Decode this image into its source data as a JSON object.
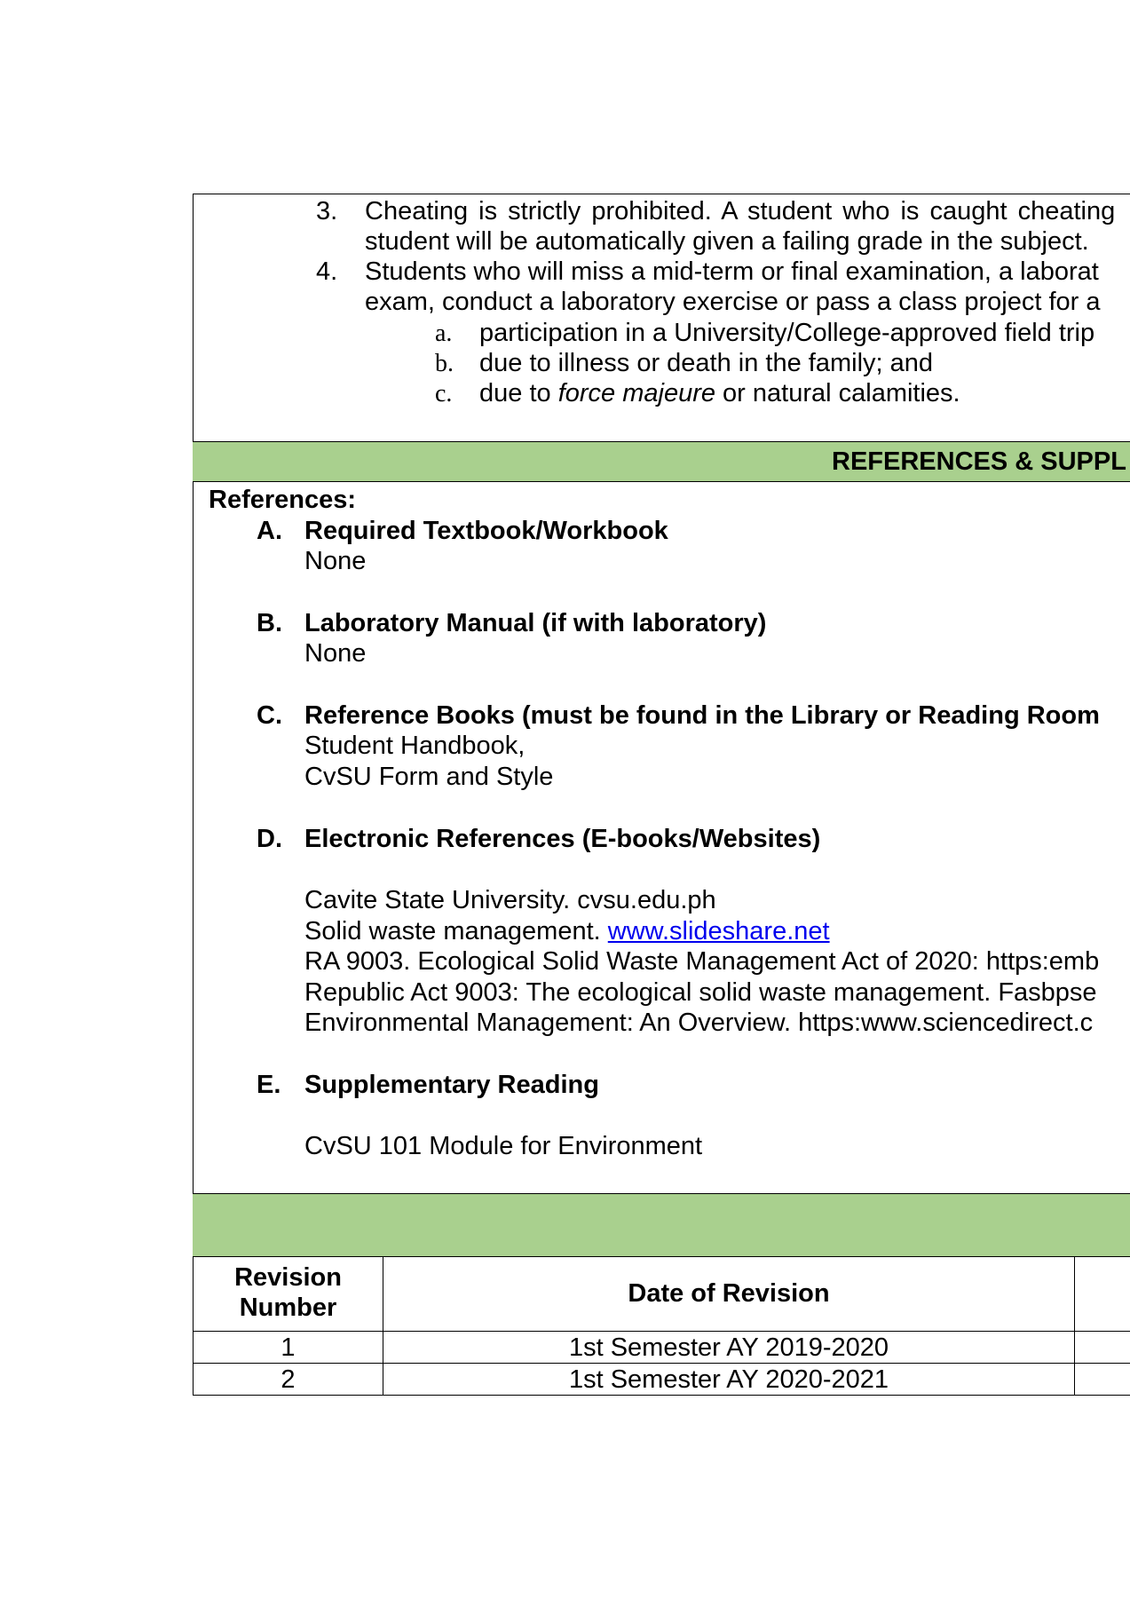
{
  "policies": [
    {
      "num": "3.",
      "lines": [
        "Cheating is strictly prohibited. A student who is caught cheating",
        "student will be automatically given a failing grade in the subject."
      ]
    },
    {
      "num": "4.",
      "lines": [
        "Students who will miss a mid-term or final examination, a laborat",
        "exam, conduct a laboratory exercise or pass a class project for a"
      ]
    }
  ],
  "subitems": [
    {
      "letter": "a.",
      "text": "participation in a University/College-approved field trip"
    },
    {
      "letter": "b.",
      "text": "due to illness or death in the family; and"
    },
    {
      "letter": "c.",
      "pre": "due to ",
      "italic": "force majeure",
      "post": " or natural calamities."
    }
  ],
  "section_header": "REFERENCES & SUPPL",
  "references": {
    "title": "References:",
    "A": {
      "letter": "A.",
      "heading": "Required Textbook/Workbook",
      "items": [
        "None"
      ]
    },
    "B": {
      "letter": "B.",
      "heading": "Laboratory Manual (if with laboratory)",
      "items": [
        "None"
      ]
    },
    "C": {
      "letter": "C.",
      "heading": "Reference Books (must be found in the Library or Reading Room",
      "items": [
        "Student Handbook,",
        "CvSU Form and Style"
      ]
    },
    "D": {
      "letter": "D.",
      "heading": "Electronic References (E-books/Websites)",
      "items": [
        "Cavite State University. cvsu.edu.ph",
        "Solid waste management. ",
        "RA 9003. Ecological Solid Waste Management Act of 2020: https:emb",
        "Republic Act 9003: The ecological solid waste management. Fasbpse",
        "Environmental Management: An Overview. https:www.sciencedirect.c"
      ],
      "link": "www.slideshare.net"
    },
    "E": {
      "letter": "E.",
      "heading": "Supplementary Reading",
      "items": [
        "CvSU 101 Module for Environment"
      ]
    }
  },
  "revision_table": {
    "headers": [
      "Revision Number",
      "Date of Revision"
    ],
    "header_lines": [
      "Revision",
      "Number"
    ],
    "rows": [
      {
        "number": "1",
        "date": "1st Semester AY 2019-2020"
      },
      {
        "number": "2",
        "date": "1st Semester AY 2020-2021"
      }
    ]
  },
  "colors": {
    "section_green": "#a9d08e",
    "link_blue": "#0000ee"
  }
}
